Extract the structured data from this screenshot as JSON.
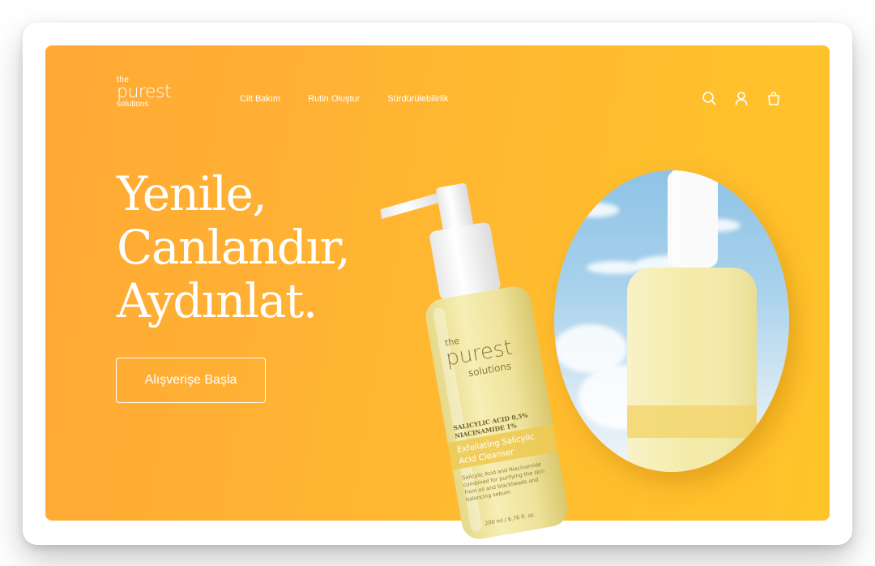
{
  "brand": {
    "line1": "the",
    "line2": "purest",
    "line3": "solutions"
  },
  "nav": {
    "items": [
      {
        "label": "Cilt Bakım"
      },
      {
        "label": "Rutin Oluştur"
      },
      {
        "label": "Sürdürülebilirlik"
      }
    ]
  },
  "header_icons": [
    "search-icon",
    "user-icon",
    "shopping-bag-icon"
  ],
  "hero": {
    "headline_lines": [
      "Yenile,",
      "Canlandır,",
      "Aydınlat."
    ],
    "cta_label": "Alışverişe Başla"
  },
  "product": {
    "brand_line1": "the",
    "brand_line2": "purest",
    "brand_line3": "solutions",
    "ingredient1": "SALICYLIC ACID 0,5%",
    "ingredient2": "NIACINAMIDE 1%",
    "name_line1": "Exfoliating Salicylic",
    "name_line2": "Acid Cleanser",
    "desc_line1": "Salicylic Acid and Niacinamide",
    "desc_line2": "combined for purifying the skin",
    "desc_line3": "from oil and blackheads and",
    "desc_line4": "balancing sebum",
    "volume": "200 ml / 6.76 fl. oz."
  },
  "colors": {
    "accent": "#ffb233",
    "bottle": "#f2e7a3",
    "label_band": "#f1c84a",
    "text": "#ffffff"
  }
}
